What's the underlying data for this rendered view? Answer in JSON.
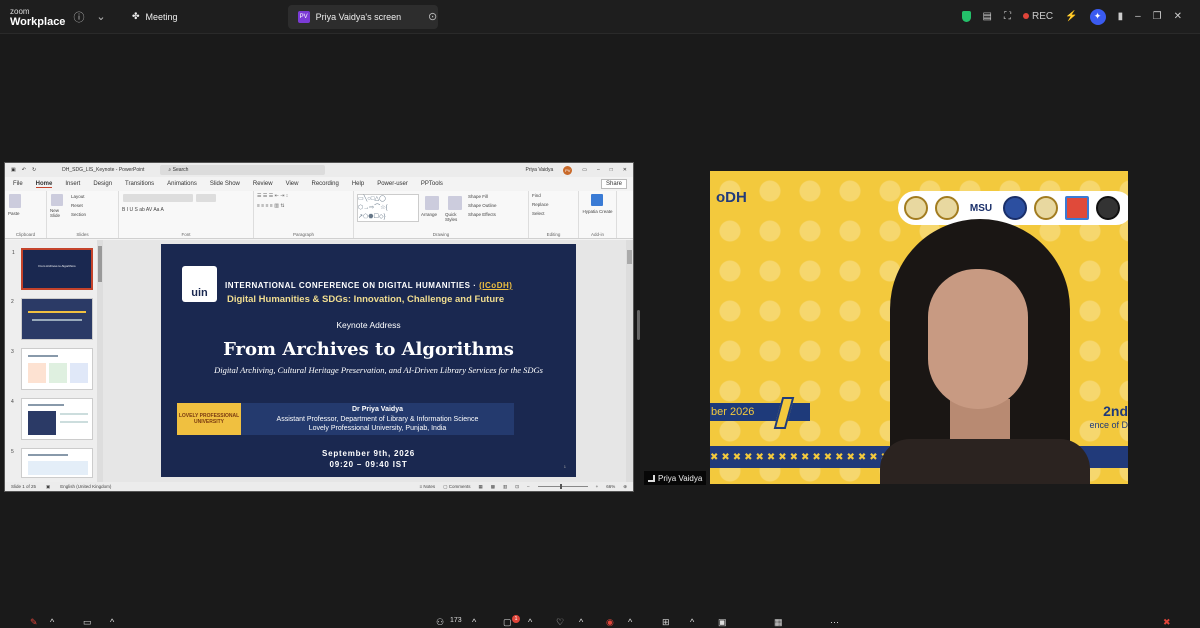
{
  "app": {
    "brand_small": "zoom",
    "brand_large": "Workplace"
  },
  "topbar": {
    "tabs": [
      {
        "label": "Meeting"
      },
      {
        "label": "Priya Vaidya's screen",
        "badge": "PV"
      }
    ],
    "rec_label": "REC"
  },
  "ppt": {
    "filename": "DH_SDG_LIS_Keynote - PowerPoint",
    "search_placeholder": "Search",
    "user_name": "Priya Vaidya",
    "user_initials": "PV",
    "menu": [
      "File",
      "Home",
      "Insert",
      "Design",
      "Transitions",
      "Animations",
      "Slide Show",
      "Review",
      "View",
      "Recording",
      "Help",
      "Power-user",
      "PPTools"
    ],
    "share_label": "Share",
    "ribbon_groups": [
      "Clipboard",
      "Slides",
      "Font",
      "Paragraph",
      "Drawing",
      "Editing",
      "Add-in"
    ],
    "ribbon_buttons": {
      "paste": "Paste",
      "new_slide": "New Slide",
      "layout": "Layout",
      "reset": "Reset",
      "section": "Section",
      "arrange": "Arrange",
      "quick_styles": "Quick Styles",
      "shape_fill": "Shape Fill",
      "shape_outline": "Shape Outline",
      "shape_effects": "Shape Effects",
      "find": "Find",
      "replace": "Replace",
      "select": "Select",
      "hypatia": "Hypatia Create"
    },
    "thumb_numbers": [
      "1",
      "2",
      "3",
      "4",
      "5"
    ],
    "thumb_titles": [
      "From Archives to Algorithms"
    ],
    "status": {
      "slide": "Slide 1 of 25",
      "language": "English (United Kingdom)",
      "notes": "Notes",
      "comments": "Comments",
      "zoom": "66%"
    }
  },
  "slide": {
    "logo": "uin",
    "conference_prefix": "INTERNATIONAL CONFERENCE ON DIGITAL HUMANITIES · ",
    "conference_acronym": "(ICoDH)",
    "theme": "Digital Humanities & SDGs: Innovation, Challenge and Future",
    "keynote": "Keynote Address",
    "title": "From Archives to Algorithms",
    "subtitle": "Digital Archiving, Cultural Heritage Preservation, and AI-Driven Library Services for the SDGs",
    "lpu_logo": "LOVELY PROFESSIONAL UNIVERSITY",
    "speaker_name": "Dr Priya Vaidya",
    "speaker_role": "Assistant Professor, Department of Library & Information Science",
    "speaker_uni": "Lovely Professional University, Punjab, India",
    "date": "September 9th, 2026",
    "time": "09:20 – 09:40 IST"
  },
  "video": {
    "banner_left": "oDH",
    "msu_logo": "MSU",
    "banner_date": "ber 2026",
    "banner_right": "2nd",
    "banner_sub": "ence of D",
    "participant": "Priya Vaidya"
  },
  "bottombar": {
    "participant_count": "173",
    "chat_badge": "1"
  },
  "colors": {
    "slide_bg": "#1a2850",
    "accent_gold": "#f0c040",
    "video_bg": "#f3c93d",
    "rec_red": "#e0453a"
  }
}
